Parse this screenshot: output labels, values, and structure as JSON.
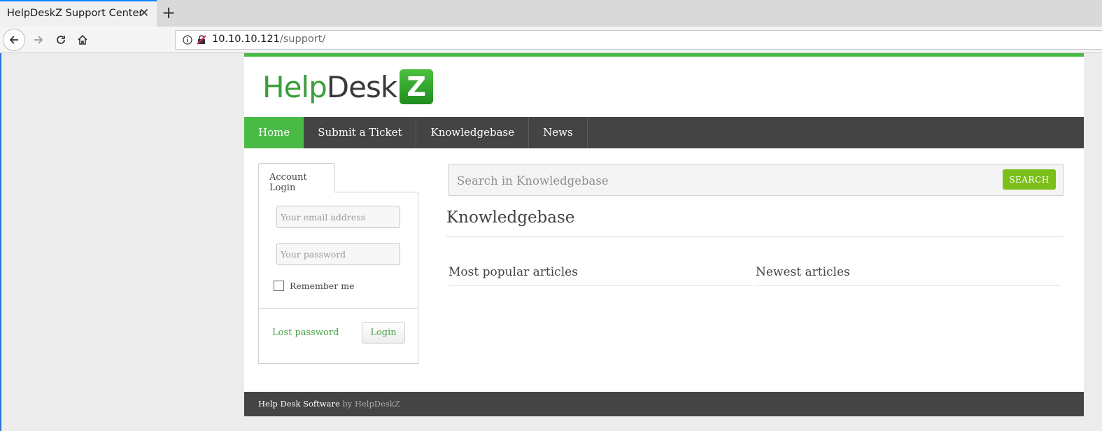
{
  "browser": {
    "tab_title": "HelpDeskZ Support Center",
    "url_host": "10.10.10.121",
    "url_path": "/support/"
  },
  "logo": {
    "help": "Help",
    "desk": "Desk",
    "z": "Z"
  },
  "colors": {
    "accent": "#4aba47",
    "nav_bg": "#444444",
    "search_button": "#7bbf1a"
  },
  "nav": {
    "items": [
      {
        "label": "Home",
        "active": true
      },
      {
        "label": "Submit a Ticket"
      },
      {
        "label": "Knowledgebase"
      },
      {
        "label": "News"
      }
    ]
  },
  "login": {
    "tab_label": "Account Login",
    "email_placeholder": "Your email address",
    "password_placeholder": "Your password",
    "remember_label": "Remember me",
    "lost_password": "Lost password",
    "login_button": "Login"
  },
  "search": {
    "placeholder": "Search in Knowledgebase",
    "button": "SEARCH"
  },
  "knowledgebase": {
    "title": "Knowledgebase",
    "popular": "Most popular articles",
    "newest": "Newest articles"
  },
  "footer": {
    "software": "Help Desk Software",
    "by": " by HelpDeskZ"
  }
}
